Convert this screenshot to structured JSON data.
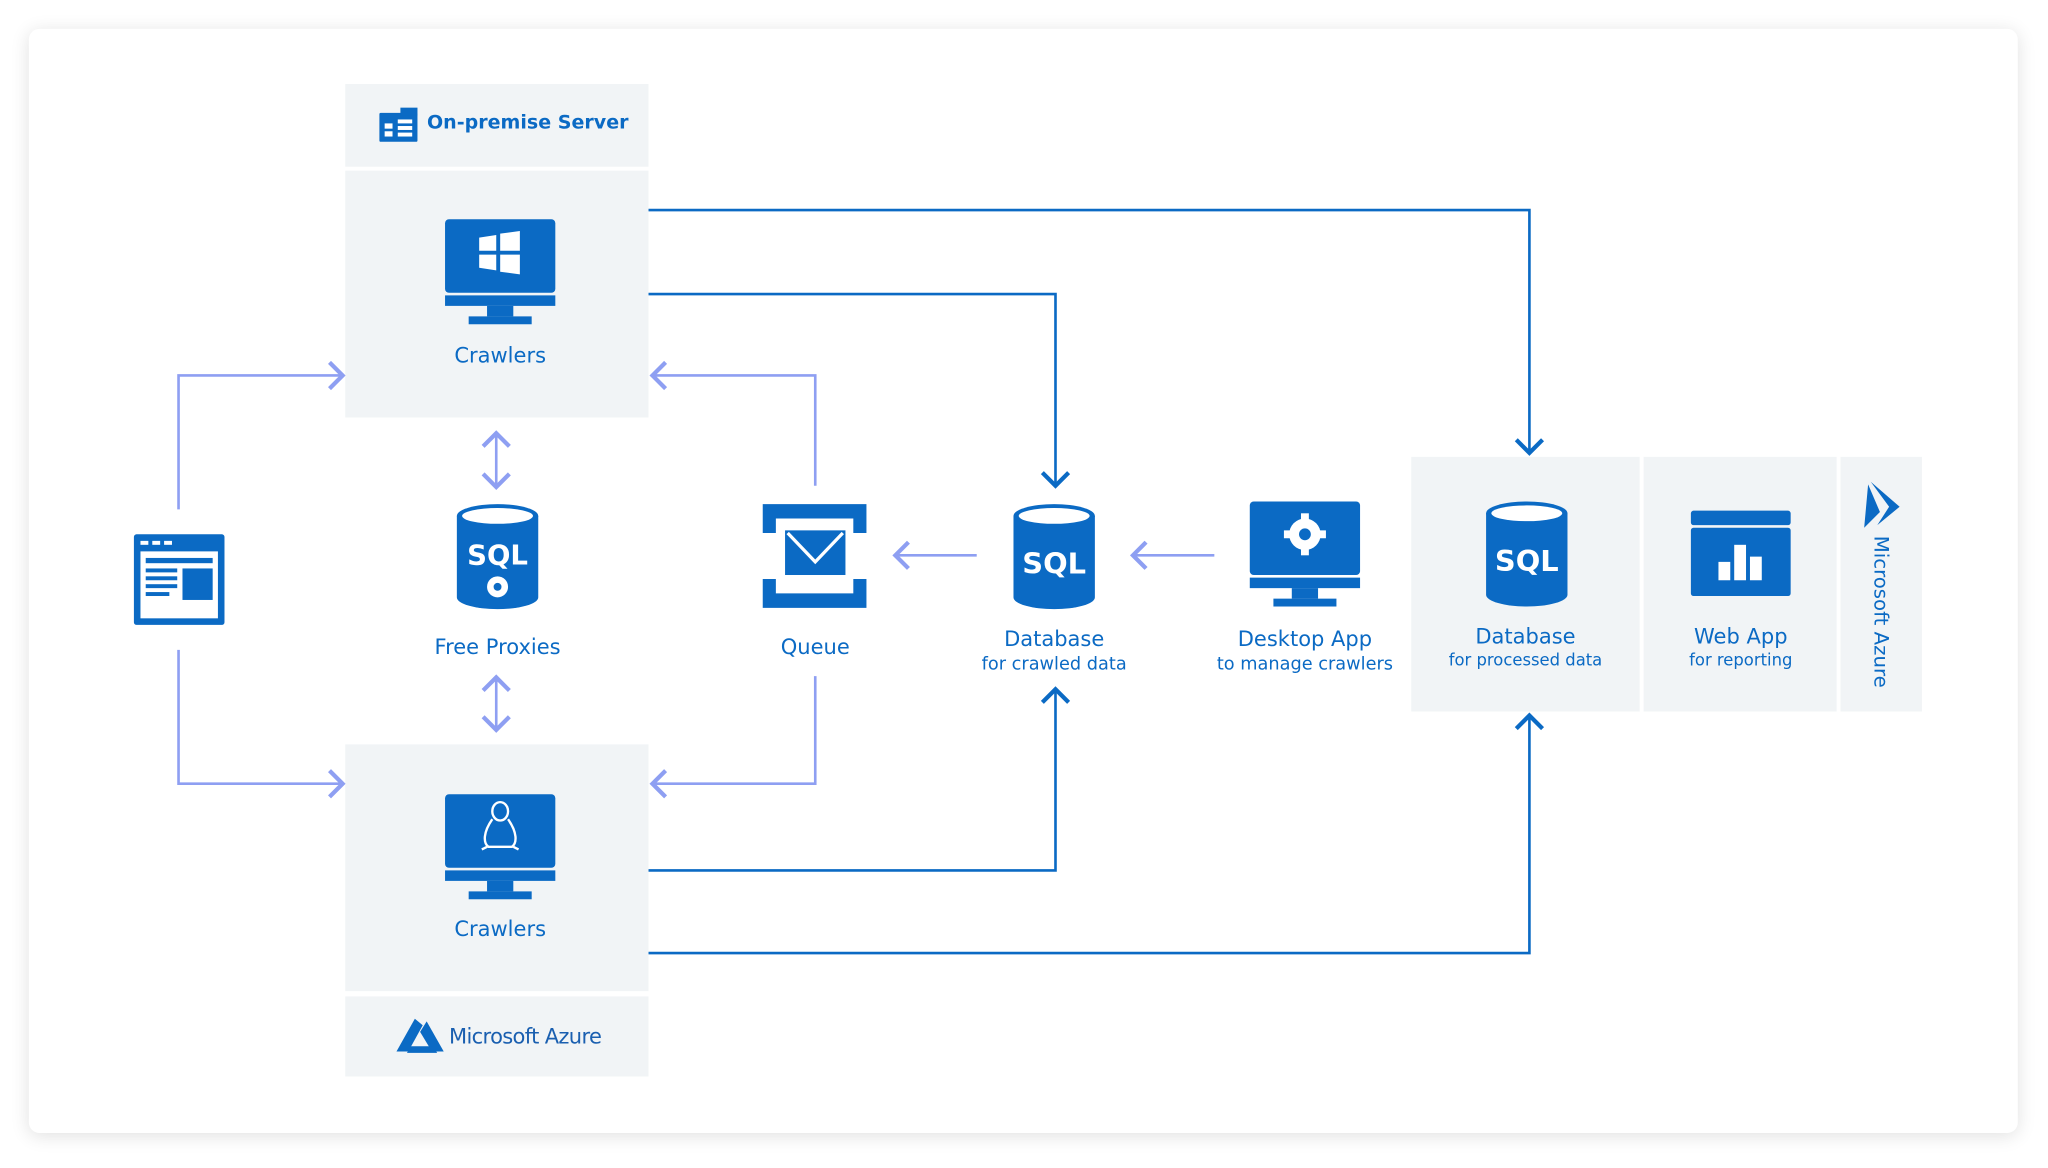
{
  "header": {
    "title": "On-premise Server",
    "icon": "office-building-icon"
  },
  "footer": {
    "brand": "Microsoft Azure",
    "icon": "azure-logo-icon"
  },
  "nodes": {
    "crawlers_windows": {
      "label": "Crawlers",
      "icon": "windows-monitor-icon"
    },
    "crawlers_linux": {
      "label": "Crawlers",
      "icon": "linux-monitor-icon"
    },
    "free_proxies": {
      "label": "Free Proxies",
      "icon": "sql-database-gear-icon"
    },
    "queue": {
      "label": "Queue",
      "icon": "queue-envelope-icon"
    },
    "db_crawled": {
      "label": "Database",
      "sublabel": "for crawled data",
      "icon": "sql-database-icon"
    },
    "desktop_app": {
      "label": "Desktop App",
      "sublabel": "to manage crawlers",
      "icon": "monitor-gear-icon"
    },
    "db_processed": {
      "label": "Database",
      "sublabel": "for processed data",
      "icon": "sql-database-icon"
    },
    "web_app": {
      "label": "Web App",
      "sublabel": "for reporting",
      "icon": "bar-chart-window-icon"
    },
    "website": {
      "icon": "browser-window-icon"
    }
  },
  "azure_side": {
    "brand": "Microsoft Azure"
  },
  "sql_text": "SQL",
  "colors": {
    "primary": "#0b6ac4",
    "light_arrow": "#8e9ff2",
    "panel": "#f1f4f6"
  }
}
